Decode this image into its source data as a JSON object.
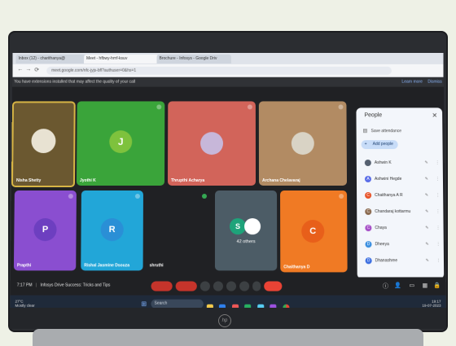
{
  "browser": {
    "tabs": [
      "Inbox (12) - charithanya@",
      "Meet - hfbwy-hmf-ksuv",
      "Brochure - Infosys - Google Driv"
    ],
    "url": "meet.google.com/nfc-jyjs-bfl?authuser=0&hs=1",
    "warning": "You have extensions installed that may affect the quality of your call",
    "learn_more": "Learn more",
    "dismiss": "Dismiss"
  },
  "tiles": [
    {
      "name": "Nisha Shetty",
      "letter": "",
      "bg": "#6b5830",
      "av": "#e8e2d2"
    },
    {
      "name": "Jyothi K",
      "letter": "J",
      "bg": "#3aa43a",
      "av": "#7ec23d"
    },
    {
      "name": "Thrupthi Acharya",
      "letter": "",
      "bg": "#d2645a",
      "av": "#c7b7d9"
    },
    {
      "name": "Archana Chelavaraj",
      "letter": "",
      "bg": "#b28b63",
      "av": "#d9d3c5"
    },
    {
      "name": "Prapthi",
      "letter": "P",
      "bg": "#8a4ed0",
      "av": "#6d3fc0"
    },
    {
      "name": "Rishal Jasmine Dsouza",
      "letter": "R",
      "bg": "#22a6d8",
      "av": "#2a8fd6"
    },
    {
      "name": "shruthi",
      "letter": "",
      "bg": "#202124",
      "av": ""
    },
    {
      "name": "42 others",
      "letter": "S",
      "bg": "#4c5c66",
      "av": "#1ea37a"
    },
    {
      "name": "Chaithanya D",
      "letter": "C",
      "bg": "#f07a24",
      "av": "#e85f1a"
    }
  ],
  "people_panel": {
    "title": "People",
    "save_attendance": "Save attendance",
    "add_people": "Add people",
    "rows": [
      {
        "name": "Ashwin K",
        "letter": "",
        "color": "#556070"
      },
      {
        "name": "Ashwini Hegde",
        "letter": "A",
        "color": "#5b6ee8"
      },
      {
        "name": "Chaithanya A R",
        "letter": "C",
        "color": "#e8552b"
      },
      {
        "name": "Chandaraj kottarmu",
        "letter": "C",
        "color": "#8a6a50"
      },
      {
        "name": "Chaya",
        "letter": "C",
        "color": "#a64fc7"
      },
      {
        "name": "Dheeya",
        "letter": "D",
        "color": "#3b8fe0"
      },
      {
        "name": "Dhanashree",
        "letter": "D",
        "color": "#3b6ee0"
      }
    ]
  },
  "meeting": {
    "time": "7:17 PM",
    "title": "Infosys Drive Success: Tricks and Tips"
  },
  "taskbar": {
    "weather_temp": "27°C",
    "weather_desc": "Mostly clear",
    "search": "Search",
    "clock_time": "19:17",
    "clock_date": "19-07-2023"
  },
  "laptop": {
    "logo": "hp"
  }
}
